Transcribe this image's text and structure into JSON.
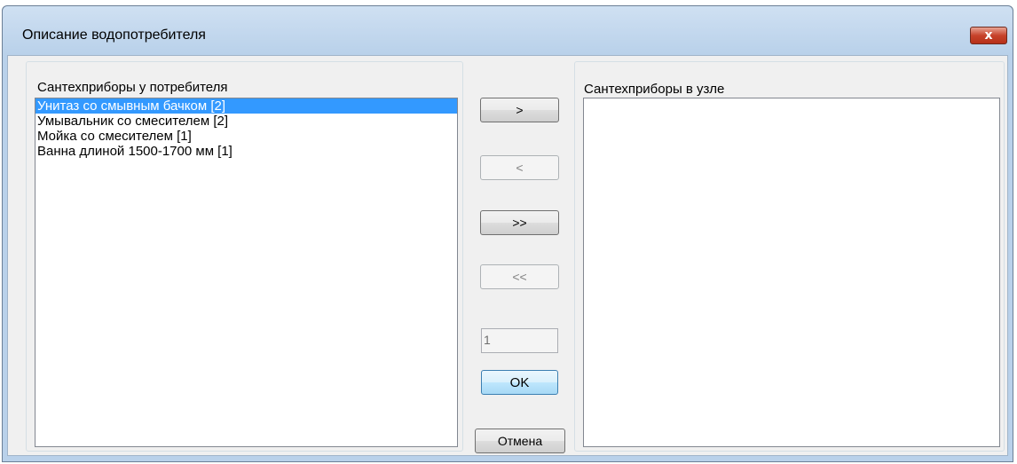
{
  "window": {
    "title": "Описание водопотребителя",
    "close_label": "x"
  },
  "left_panel": {
    "label": "Сантехприборы у потребителя",
    "items": [
      {
        "label": "Унитаз со смывным бачком  [2]",
        "selected": true
      },
      {
        "label": "Умывальник со смесителем  [2]",
        "selected": false
      },
      {
        "label": "Мойка  со смесителем  [1]",
        "selected": false
      },
      {
        "label": "Ванна длиной 1500-1700 мм  [1]",
        "selected": false
      }
    ]
  },
  "right_panel": {
    "label": "Сантехприборы в узле",
    "items": []
  },
  "buttons": {
    "move_right": ">",
    "move_left": "<",
    "move_all_right": ">>",
    "move_all_left": "<<",
    "ok": "OK",
    "cancel": "Отмена"
  },
  "quantity": {
    "value": "1"
  },
  "colors": {
    "selection": "#3399ff",
    "frame": "#b9d1ea",
    "close_button": "#c7432b"
  }
}
